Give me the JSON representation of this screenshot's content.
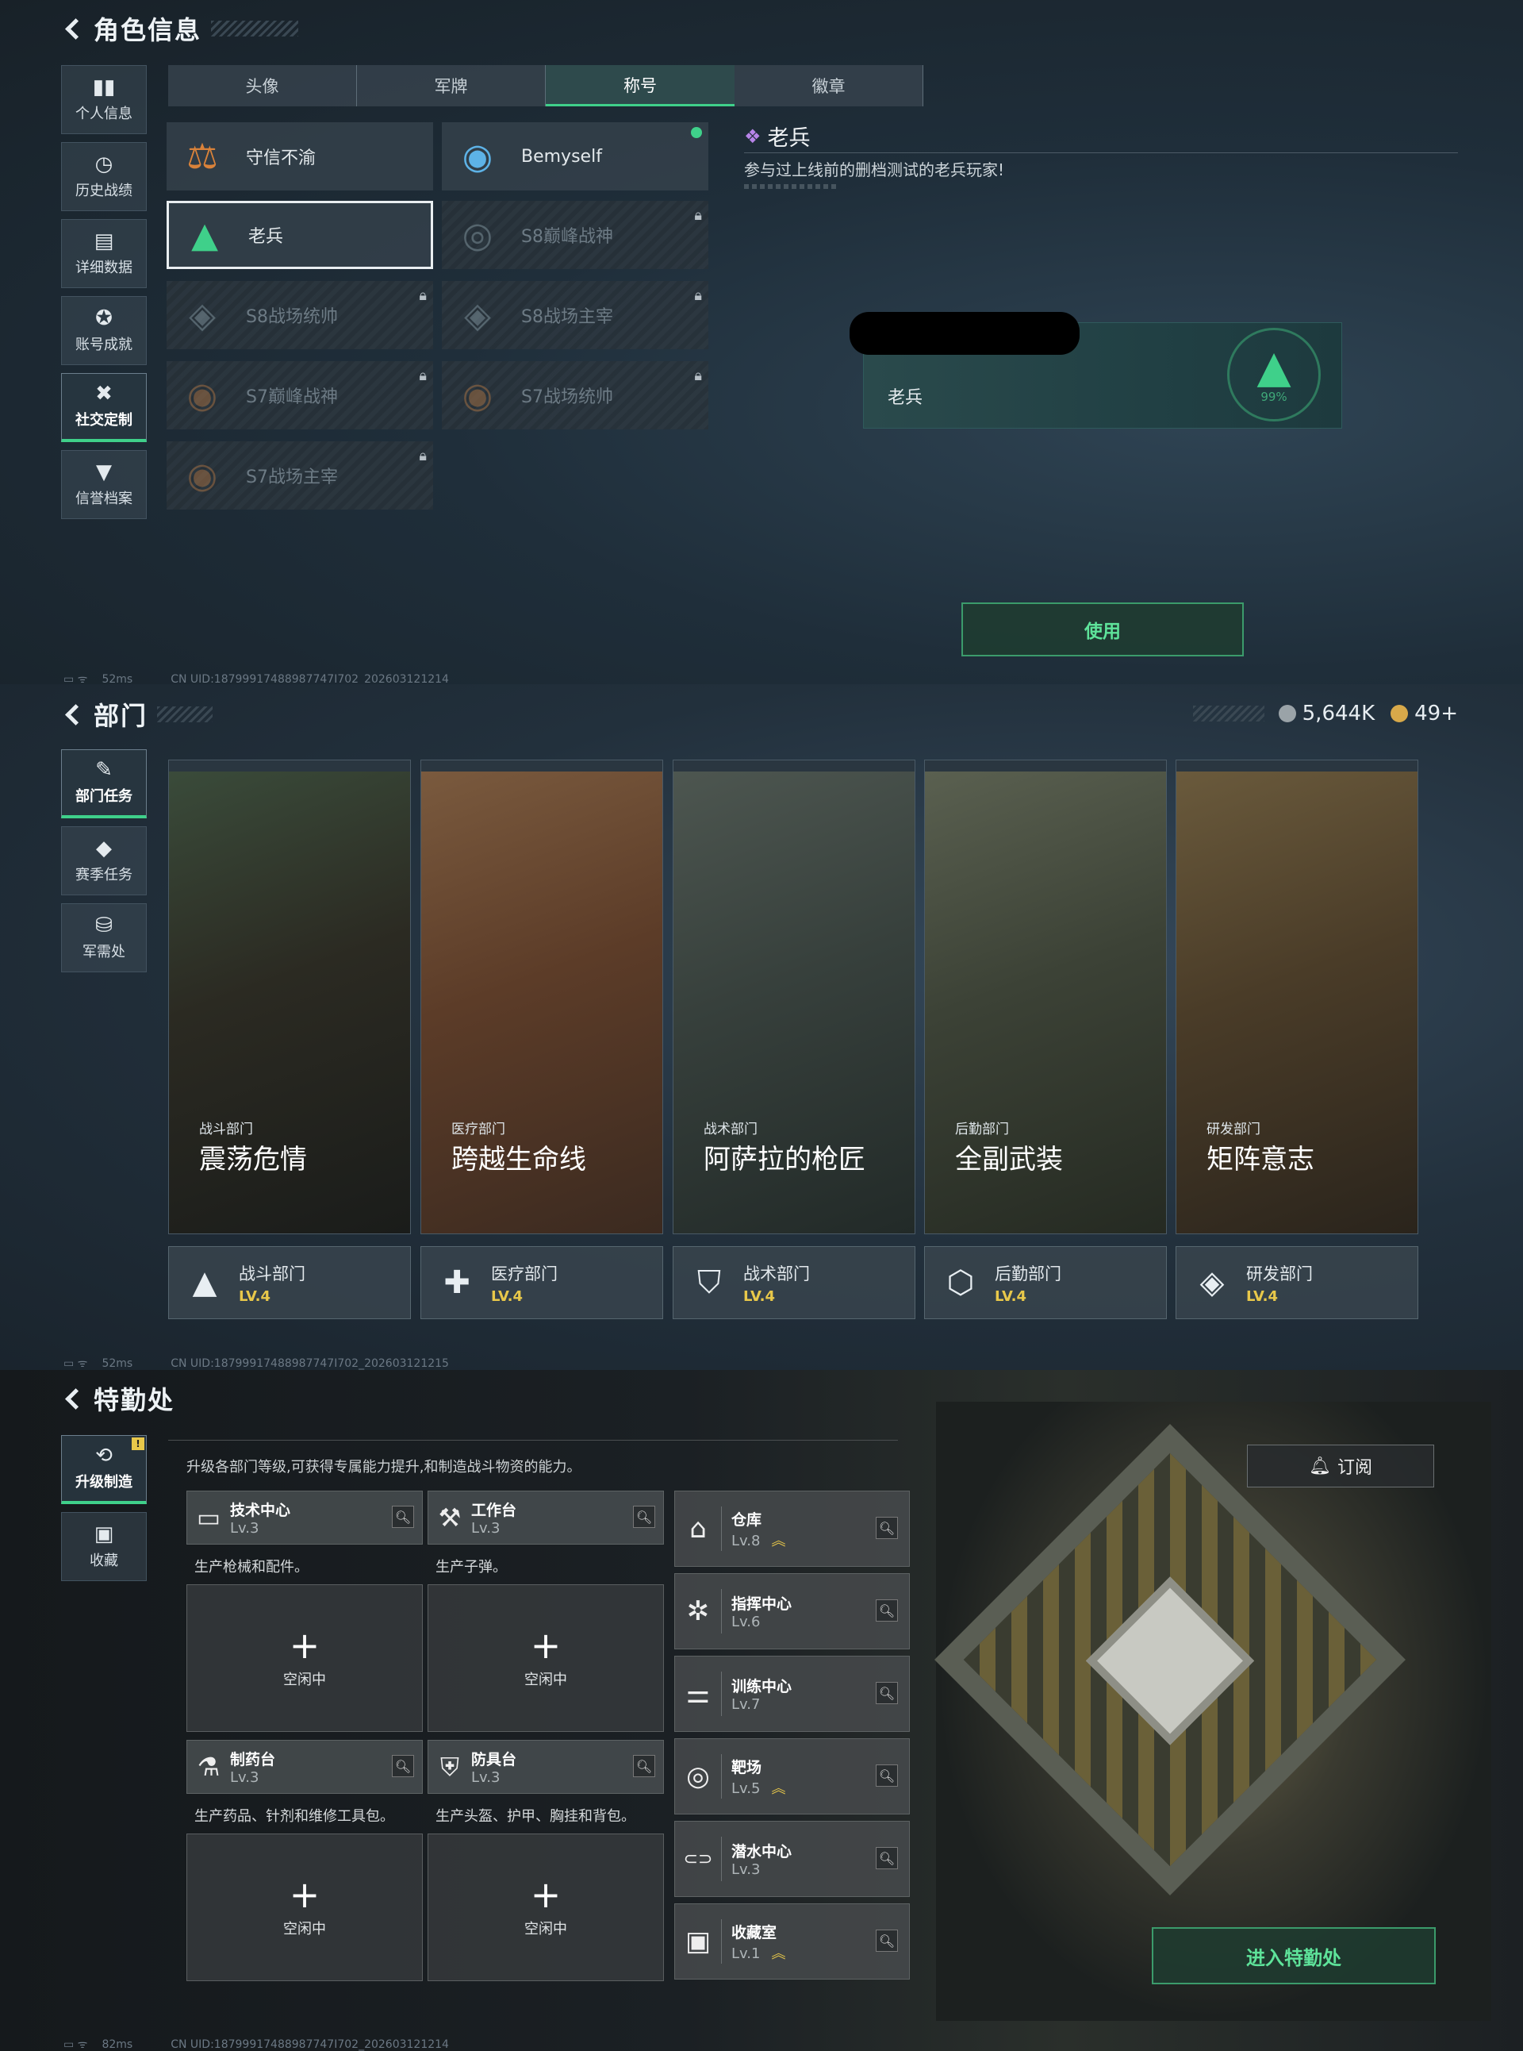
{
  "profile": {
    "title": "角色信息",
    "sidebar": [
      {
        "icon": "▮▮",
        "label": "个人信息"
      },
      {
        "icon": "◷",
        "label": "历史战绩"
      },
      {
        "icon": "▤",
        "label": "详细数据"
      },
      {
        "icon": "✪",
        "label": "账号成就"
      },
      {
        "icon": "✖",
        "label": "社交定制"
      },
      {
        "icon": "▼",
        "label": "信誉档案"
      }
    ],
    "tabs": [
      "头像",
      "军牌",
      "称号",
      "徽章"
    ],
    "titles": [
      {
        "name": "守信不渝",
        "emblem": "⚖",
        "color": "#d9823a"
      },
      {
        "name": "Bemyself",
        "emblem": "◉",
        "color": "#5db2e6"
      },
      {
        "name": "老兵",
        "emblem": "▲",
        "color": "#3fd08a"
      },
      {
        "name": "S8巅峰战神",
        "emblem": "◎",
        "color": "#8aa0aa"
      },
      {
        "name": "S8战场统帅",
        "emblem": "◈",
        "color": "#8aa0aa"
      },
      {
        "name": "S8战场主宰",
        "emblem": "◈",
        "color": "#8aa0aa"
      },
      {
        "name": "S7巅峰战神",
        "emblem": "◉",
        "color": "#b87a45"
      },
      {
        "name": "S7战场统帅",
        "emblem": "◉",
        "color": "#b87a45"
      },
      {
        "name": "S7战场主宰",
        "emblem": "◉",
        "color": "#b87a45"
      }
    ],
    "detail": {
      "name": "老兵",
      "desc": "参与过上线前的删档测试的老兵玩家!",
      "card_name": "老兵",
      "card_percent": "99%"
    },
    "use_button": "使用",
    "ping": "52ms",
    "uid": "CN UID:18799917488987747I702_202603121214"
  },
  "dept": {
    "title": "部门",
    "currency1": "5,644K",
    "currency2": "49+",
    "sidebar": [
      {
        "icon": "✎",
        "label": "部门任务"
      },
      {
        "icon": "◆",
        "label": "赛季任务"
      },
      {
        "icon": "⛁",
        "label": "军需处"
      }
    ],
    "cards": [
      {
        "category": "战斗部门",
        "name": "震荡危情",
        "dept": "战斗部门",
        "level": "LV.4",
        "icon": "▲",
        "bg": "linear-gradient(160deg,#3a4b3a 0%,#2b2a22 45%,#1a1c1a 100%)"
      },
      {
        "category": "医疗部门",
        "name": "跨越生命线",
        "dept": "医疗部门",
        "level": "LV.4",
        "icon": "✚",
        "bg": "linear-gradient(160deg,#7a5a3e 0%,#5c3c28 45%,#3b2a20 100%)"
      },
      {
        "category": "战术部门",
        "name": "阿萨拉的枪匠",
        "dept": "战术部门",
        "level": "LV.4",
        "icon": "⛉",
        "bg": "linear-gradient(160deg,#4d5650 0%,#37403c 45%,#222a28 100%)"
      },
      {
        "category": "后勤部门",
        "name": "全副武装",
        "dept": "后勤部门",
        "level": "LV.4",
        "icon": "⬡",
        "bg": "linear-gradient(160deg,#5a6050 0%,#3c4236 45%,#252a22 100%)"
      },
      {
        "category": "研发部门",
        "name": "矩阵意志",
        "dept": "研发部门",
        "level": "LV.4",
        "icon": "◈",
        "bg": "linear-gradient(160deg,#6a5a3c 0%,#4a3c28 45%,#2a241c 100%)"
      }
    ],
    "ping": "52ms",
    "uid": "CN UID:18799917488987747I702_202603121215"
  },
  "special": {
    "title": "特勤处",
    "sidebar": [
      {
        "icon": "⟲",
        "label": "升级制造",
        "badge": "!"
      },
      {
        "icon": "▣",
        "label": "收藏"
      }
    ],
    "intro": "升级各部门等级,可获得专属能力提升,和制造战斗物资的能力。",
    "workshops": [
      {
        "name": "技术中心",
        "level": "Lv.3",
        "desc": "生产枪械和配件。",
        "icon": "▭",
        "idle": "空闲中"
      },
      {
        "name": "工作台",
        "level": "Lv.3",
        "desc": "生产子弹。",
        "icon": "⚒",
        "idle": "空闲中"
      },
      {
        "name": "制药台",
        "level": "Lv.3",
        "desc": "生产药品、针剂和维修工具包。",
        "icon": "⚗",
        "idle": "空闲中"
      },
      {
        "name": "防具台",
        "level": "Lv.3",
        "desc": "生产头盔、护甲、胸挂和背包。",
        "icon": "⛨",
        "idle": "空闲中"
      }
    ],
    "facilities": [
      {
        "name": "仓库",
        "level": "Lv.8",
        "icon": "⌂",
        "upgrade": "︽"
      },
      {
        "name": "指挥中心",
        "level": "Lv.6",
        "icon": "✲",
        "upgrade": ""
      },
      {
        "name": "训练中心",
        "level": "Lv.7",
        "icon": "⚌",
        "upgrade": ""
      },
      {
        "name": "靶场",
        "level": "Lv.5",
        "icon": "◎",
        "upgrade": "︽"
      },
      {
        "name": "潜水中心",
        "level": "Lv.3",
        "icon": "⊂⊃",
        "upgrade": ""
      },
      {
        "name": "收藏室",
        "level": "Lv.1",
        "icon": "▣",
        "upgrade": "︽"
      }
    ],
    "subscribe": "订阅",
    "enter_button": "进入特勤处",
    "ping": "82ms",
    "uid": "CN UID:18799917488987747I702_202603121214"
  }
}
